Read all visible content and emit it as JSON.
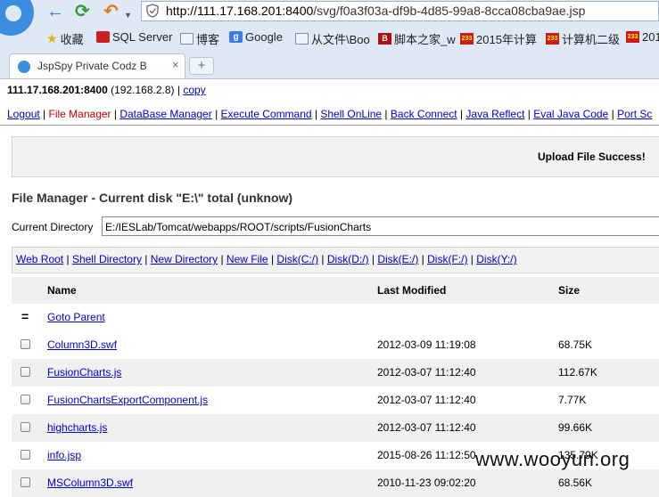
{
  "browser": {
    "url_host": "http://111.17.168.201:8400",
    "url_path": "/svg/f0a3f03a-df9b-4d85-99a8-8cca08cba9ae.jsp",
    "bookmarks": [
      {
        "icon": "star-icon",
        "label": "收藏"
      },
      {
        "icon": "sql-icon",
        "label": "SQL Server"
      },
      {
        "icon": "folder-icon",
        "label": "博客"
      },
      {
        "icon": "google-icon",
        "label": "Google"
      },
      {
        "icon": "folder-icon",
        "label": "从文件\\Boo"
      },
      {
        "icon": "jb-icon",
        "label": "脚本之家_w"
      },
      {
        "icon": "233-icon",
        "label": "2015年计算"
      },
      {
        "icon": "233-icon",
        "label": "计算机二级"
      },
      {
        "icon": "233-icon",
        "label": "201"
      }
    ],
    "tab_title": "JspSpy Private Codz B",
    "tab_close": "×",
    "new_tab": "+"
  },
  "header": {
    "host": "111.17.168.201:8400",
    "ip": "(192.168.2.8)",
    "copy": "copy"
  },
  "menu": [
    "Logout",
    "File Manager",
    "DataBase Manager",
    "Execute Command",
    "Shell OnLine",
    "Back Connect",
    "Java Reflect",
    "Eval Java Code",
    "Port Sc"
  ],
  "upload_message": "Upload File Success!",
  "file_manager": {
    "title": "File Manager - Current disk \"E:\\\" total (unknow)",
    "dir_label": "Current Directory",
    "dir_value": "E:/IESLab/Tomcat/webapps/ROOT/scripts/FusionCharts",
    "drive_links": [
      "Web Root",
      "Shell Directory",
      "New Directory",
      "New File",
      "Disk(C:/)",
      "Disk(D:/)",
      "Disk(E:/)",
      "Disk(F:/)",
      "Disk(Y:/)"
    ],
    "columns": {
      "name": "Name",
      "modified": "Last Modified",
      "size": "Size"
    },
    "parent_symbol": "=",
    "parent_label": "Goto Parent",
    "files": [
      {
        "name": "Column3D.swf",
        "modified": "2012-03-09 11:19:08",
        "size": "68.75K"
      },
      {
        "name": "FusionCharts.js",
        "modified": "2012-03-07 11:12:40",
        "size": "112.67K"
      },
      {
        "name": "FusionChartsExportComponent.js",
        "modified": "2012-03-07 11:12:40",
        "size": "7.77K"
      },
      {
        "name": "highcharts.js",
        "modified": "2012-03-07 11:12:40",
        "size": "99.66K"
      },
      {
        "name": "info.jsp",
        "modified": "2015-08-26 11:12:50",
        "size": "135.79K"
      },
      {
        "name": "MSColumn3D.swf",
        "modified": "2010-11-23 09:02:20",
        "size": "68.56K"
      }
    ]
  },
  "watermark": "www.wooyun.org"
}
